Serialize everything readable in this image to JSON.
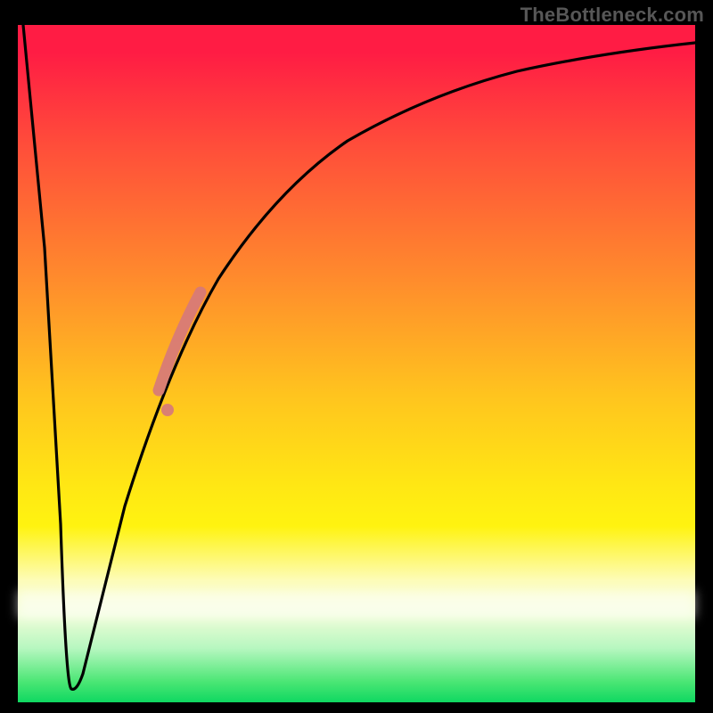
{
  "watermark": "TheBottleneck.com",
  "colors": {
    "curve": "#000000",
    "highlight": "#d77a7a",
    "frame": "#000000"
  },
  "chart_data": {
    "type": "line",
    "title": "",
    "xlabel": "",
    "ylabel": "",
    "xlim": [
      0,
      100
    ],
    "ylim": [
      0,
      100
    ],
    "series": [
      {
        "name": "bottleneck-curve",
        "x": [
          0,
          3,
          5,
          7,
          9,
          10,
          12,
          15,
          18,
          22,
          26,
          30,
          35,
          40,
          46,
          52,
          60,
          70,
          82,
          92,
          100
        ],
        "y": [
          100,
          60,
          20,
          2,
          1,
          4,
          12,
          28,
          42,
          55,
          64,
          71,
          77,
          82,
          86,
          89,
          92,
          94.5,
          96.3,
          97.2,
          97.8
        ]
      }
    ],
    "highlight_segment": {
      "series": "bottleneck-curve",
      "x_start": 20,
      "x_end": 27,
      "note": "salmon highlighted portion on ascending branch"
    },
    "highlight_dot": {
      "x": 21,
      "y": 53
    }
  }
}
